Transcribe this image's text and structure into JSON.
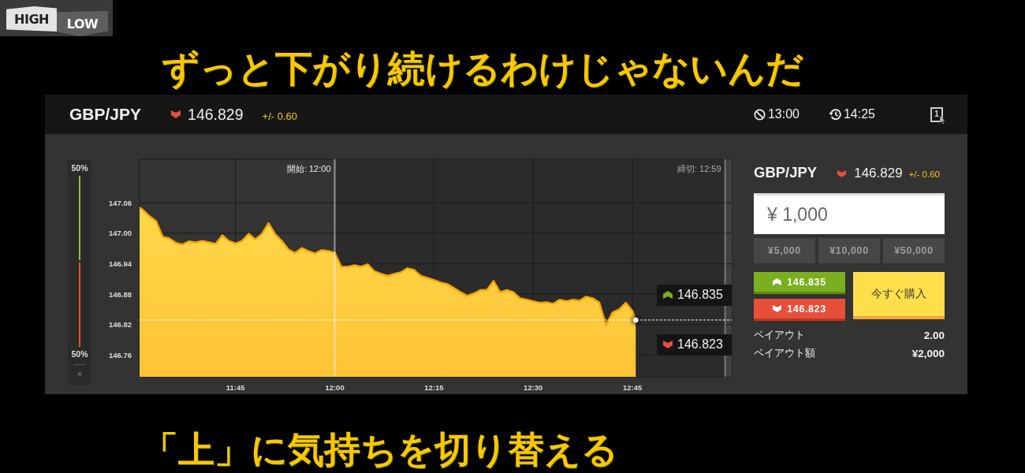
{
  "logo": {
    "high": "HIGH",
    "low": "LOW"
  },
  "caption_top": "ずっと下がり続けるわけじゃないんだ",
  "header": {
    "pair": "GBP/JPY",
    "falling": true,
    "price": "146.829",
    "change": "+/- 0.60",
    "deadline_time": "13:00",
    "expiry_time": "14:25",
    "window_count": "1"
  },
  "sentiment": {
    "high_percent": "50%",
    "level": 0.5,
    "low_percent": "50%",
    "close": "×"
  },
  "chart": {
    "time_labels": [
      "開始: 12:00",
      "締切: 12:59"
    ],
    "high_tag": "146.835",
    "low_tag": "146.823",
    "chart_data": {
      "type": "area",
      "x": [
        690.5,
        691,
        692,
        693,
        694,
        695,
        696,
        697,
        698,
        699,
        700,
        701,
        702,
        703,
        704,
        705,
        706,
        707,
        708,
        709,
        710,
        711,
        712,
        713,
        714,
        715,
        716,
        717,
        718,
        719,
        720,
        721,
        722,
        723,
        724,
        725,
        726,
        727,
        728,
        729,
        730,
        731,
        732,
        733,
        734,
        735,
        736,
        737,
        738,
        739,
        740,
        741,
        742,
        743,
        744,
        745,
        746,
        747,
        748,
        749,
        750,
        751,
        752,
        753,
        754,
        755,
        756,
        757,
        758,
        759,
        760,
        761,
        762,
        763,
        764,
        765,
        765.5
      ],
      "values": [
        147.051,
        147.046,
        147.034,
        147.024,
        146.993,
        146.99,
        146.981,
        146.978,
        146.984,
        146.982,
        146.985,
        146.982,
        146.979,
        146.996,
        146.985,
        146.98,
        146.985,
        146.999,
        146.988,
        146.999,
        147.02,
        146.998,
        146.985,
        146.968,
        146.961,
        146.971,
        146.965,
        146.96,
        146.967,
        146.965,
        146.962,
        146.934,
        146.934,
        146.937,
        146.934,
        146.939,
        146.925,
        146.92,
        146.916,
        146.92,
        146.923,
        146.931,
        146.928,
        146.916,
        146.912,
        146.908,
        146.903,
        146.9,
        146.892,
        146.884,
        146.877,
        146.881,
        146.888,
        146.888,
        146.906,
        146.884,
        146.888,
        146.884,
        146.872,
        146.869,
        146.866,
        146.863,
        146.864,
        146.861,
        146.869,
        146.866,
        146.869,
        146.867,
        146.875,
        146.872,
        146.863,
        146.819,
        146.844,
        146.85,
        146.863,
        146.847,
        146.829
      ],
      "xlim": [
        690.5,
        780
      ],
      "ylim": [
        146.717,
        147.146
      ],
      "grid": true,
      "xticks": [
        {
          "value": 705,
          "label": "11:45"
        },
        {
          "value": 720,
          "label": "12:00"
        },
        {
          "value": 735,
          "label": "12:15"
        },
        {
          "value": 750,
          "label": "12:30"
        },
        {
          "value": 765,
          "label": "12:45"
        }
      ],
      "yticks": [
        {
          "value": 147.06,
          "label": "147.06"
        },
        {
          "value": 147.0,
          "label": "147.00"
        },
        {
          "value": 146.94,
          "label": "146.94"
        },
        {
          "value": 146.88,
          "label": "146.88"
        },
        {
          "value": 146.82,
          "label": "146.82"
        },
        {
          "value": 146.76,
          "label": "146.76"
        }
      ],
      "bands": [
        {
          "axis": "x",
          "from": 720,
          "to": 780,
          "color": "#2b2b2b"
        },
        {
          "axis": "x",
          "from": 779,
          "to": 780,
          "color": "#404040"
        }
      ],
      "ref_lines": [
        {
          "axis": "x",
          "value": 720,
          "color": "#eeeeee"
        },
        {
          "axis": "x",
          "value": 779,
          "color": "#aaaaaa"
        },
        {
          "axis": "y",
          "value": 146.829,
          "color": "#ffffff"
        }
      ]
    }
  },
  "trade_panel": {
    "pair": "GBP/JPY",
    "falling": true,
    "price": "146.829",
    "change": "+/- 0.60",
    "amount": "¥ 1,000",
    "quick_amounts": [
      "¥5,000",
      "¥10,000",
      "¥50,000"
    ],
    "options": [
      {
        "kind": "high",
        "price": "146.835"
      },
      {
        "kind": "low",
        "price": "146.823"
      }
    ],
    "buy": "今すぐ購入",
    "payout": [
      {
        "label": "ペイアウト",
        "value": "2.00"
      },
      {
        "label": "ペイアウト額",
        "value": "¥2,000"
      }
    ]
  },
  "caption_bottom": "「上」に気持ちを切り替える"
}
